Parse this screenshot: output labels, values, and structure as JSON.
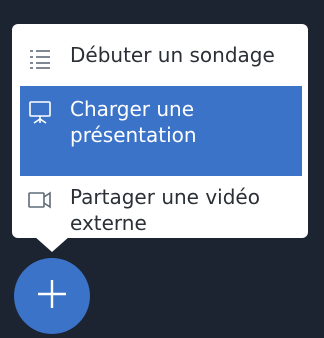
{
  "menu": {
    "items": [
      {
        "label": "Débuter un sondage",
        "icon": "list-icon"
      },
      {
        "label": "Charger une présentation",
        "icon": "presentation-icon"
      },
      {
        "label": "Partager une vidéo externe",
        "icon": "video-camera-icon"
      }
    ],
    "active_index": 1
  },
  "fab": {
    "icon": "plus-icon"
  },
  "colors": {
    "background": "#1b2430",
    "accent": "#3b73c8",
    "menu_bg": "#ffffff",
    "text": "#2b2f36"
  }
}
